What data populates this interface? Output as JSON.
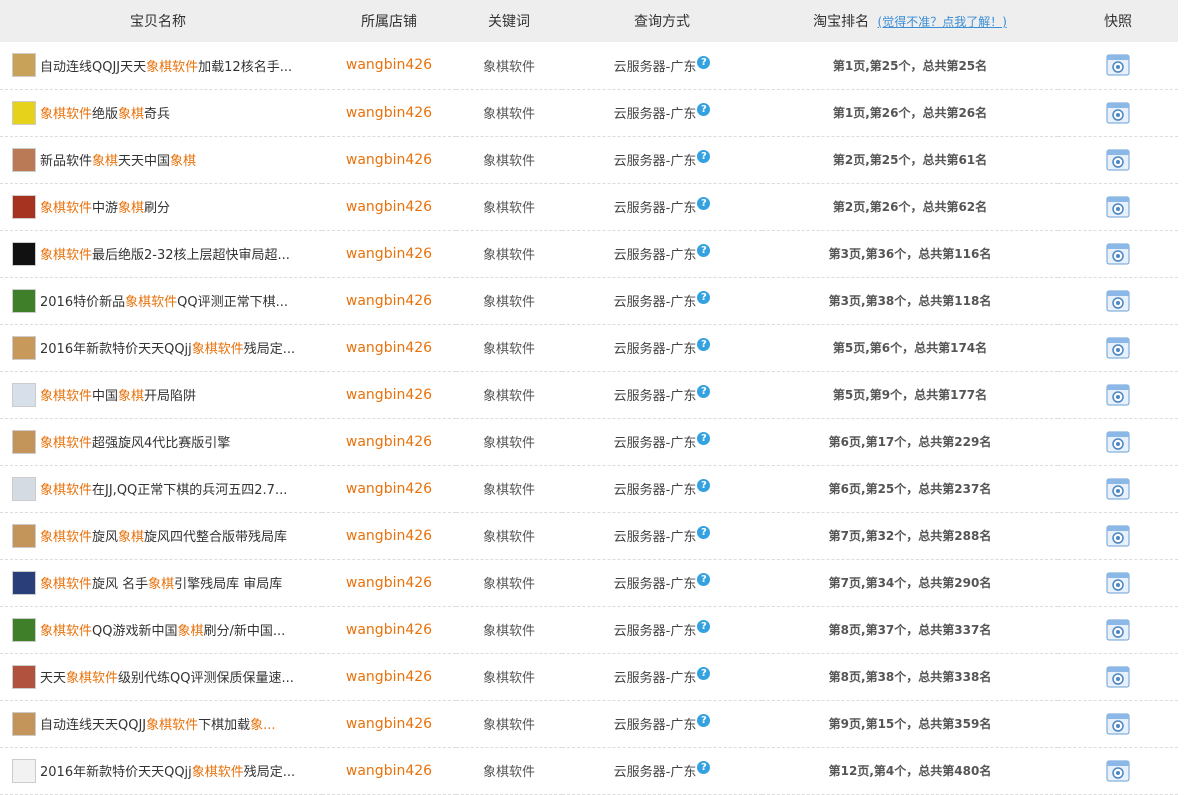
{
  "header": {
    "col_name": "宝贝名称",
    "col_store": "所属店铺",
    "col_keyword": "关键词",
    "col_method": "查询方式",
    "col_rank": "淘宝排名",
    "rank_hint": "(觉得不准？点我了解！)",
    "col_snapshot": "快照"
  },
  "rows": [
    {
      "thumb": "#c9a25a",
      "parts": [
        {
          "t": "自动连线QQJJ天天"
        },
        {
          "t": "象棋软件",
          "h": true
        },
        {
          "t": "加载12核名手..."
        }
      ],
      "store": "wangbin426",
      "keyword": "象棋软件",
      "method": "云服务器-广东",
      "rank": "第1页,第25个，总共第25名"
    },
    {
      "thumb": "#e6d21a",
      "parts": [
        {
          "t": "象棋软件",
          "h": true
        },
        {
          "t": "绝版"
        },
        {
          "t": "象棋",
          "h": true
        },
        {
          "t": "奇兵"
        }
      ],
      "store": "wangbin426",
      "keyword": "象棋软件",
      "method": "云服务器-广东",
      "rank": "第1页,第26个，总共第26名"
    },
    {
      "thumb": "#b97a55",
      "parts": [
        {
          "t": "新品软件"
        },
        {
          "t": "象棋",
          "h": true
        },
        {
          "t": "天天中国"
        },
        {
          "t": "象棋",
          "h": true
        }
      ],
      "store": "wangbin426",
      "keyword": "象棋软件",
      "method": "云服务器-广东",
      "rank": "第2页,第25个，总共第61名"
    },
    {
      "thumb": "#a5331f",
      "parts": [
        {
          "t": "象棋软件",
          "h": true
        },
        {
          "t": "中游"
        },
        {
          "t": "象棋",
          "h": true
        },
        {
          "t": "刷分"
        }
      ],
      "store": "wangbin426",
      "keyword": "象棋软件",
      "method": "云服务器-广东",
      "rank": "第2页,第26个，总共第62名"
    },
    {
      "thumb": "#111111",
      "parts": [
        {
          "t": "象棋软件",
          "h": true
        },
        {
          "t": "最后绝版2-32核上层超快审局超..."
        }
      ],
      "store": "wangbin426",
      "keyword": "象棋软件",
      "method": "云服务器-广东",
      "rank": "第3页,第36个，总共第116名"
    },
    {
      "thumb": "#3f7f2a",
      "parts": [
        {
          "t": "2016特价新品"
        },
        {
          "t": "象棋软件",
          "h": true
        },
        {
          "t": "QQ评测正常下棋..."
        }
      ],
      "store": "wangbin426",
      "keyword": "象棋软件",
      "method": "云服务器-广东",
      "rank": "第3页,第38个，总共第118名"
    },
    {
      "thumb": "#c79a5c",
      "parts": [
        {
          "t": "2016年新款特价天天QQjj"
        },
        {
          "t": "象棋软件",
          "h": true
        },
        {
          "t": "残局定..."
        }
      ],
      "store": "wangbin426",
      "keyword": "象棋软件",
      "method": "云服务器-广东",
      "rank": "第5页,第6个，总共第174名"
    },
    {
      "thumb": "#d7e0ea",
      "parts": [
        {
          "t": "象棋软件",
          "h": true
        },
        {
          "t": "中国"
        },
        {
          "t": "象棋",
          "h": true
        },
        {
          "t": "开局陷阱"
        }
      ],
      "store": "wangbin426",
      "keyword": "象棋软件",
      "method": "云服务器-广东",
      "rank": "第5页,第9个，总共第177名"
    },
    {
      "thumb": "#c4955a",
      "parts": [
        {
          "t": "象棋软件",
          "h": true
        },
        {
          "t": "超强旋风4代比赛版引擎"
        }
      ],
      "store": "wangbin426",
      "keyword": "象棋软件",
      "method": "云服务器-广东",
      "rank": "第6页,第17个，总共第229名"
    },
    {
      "thumb": "#d5dbe2",
      "parts": [
        {
          "t": "象棋软件",
          "h": true
        },
        {
          "t": "在JJ,QQ正常下棋的兵河五四2.7..."
        }
      ],
      "store": "wangbin426",
      "keyword": "象棋软件",
      "method": "云服务器-广东",
      "rank": "第6页,第25个，总共第237名"
    },
    {
      "thumb": "#c4955a",
      "parts": [
        {
          "t": "象棋软件",
          "h": true
        },
        {
          "t": "旋风"
        },
        {
          "t": "象棋",
          "h": true
        },
        {
          "t": "旋风四代整合版带残局库"
        }
      ],
      "store": "wangbin426",
      "keyword": "象棋软件",
      "method": "云服务器-广东",
      "rank": "第7页,第32个，总共第288名"
    },
    {
      "thumb": "#2a3f7a",
      "parts": [
        {
          "t": "象棋软件",
          "h": true
        },
        {
          "t": "旋风 名手"
        },
        {
          "t": "象棋",
          "h": true
        },
        {
          "t": "引擎残局库 审局库"
        }
      ],
      "store": "wangbin426",
      "keyword": "象棋软件",
      "method": "云服务器-广东",
      "rank": "第7页,第34个，总共第290名"
    },
    {
      "thumb": "#3f7f2a",
      "parts": [
        {
          "t": "象棋软件",
          "h": true
        },
        {
          "t": "QQ游戏新中国"
        },
        {
          "t": "象棋",
          "h": true
        },
        {
          "t": "刷分/新中国..."
        }
      ],
      "store": "wangbin426",
      "keyword": "象棋软件",
      "method": "云服务器-广东",
      "rank": "第8页,第37个，总共第337名"
    },
    {
      "thumb": "#b0523d",
      "parts": [
        {
          "t": "天天"
        },
        {
          "t": "象棋软件",
          "h": true
        },
        {
          "t": "级别代练QQ评测保质保量速..."
        }
      ],
      "store": "wangbin426",
      "keyword": "象棋软件",
      "method": "云服务器-广东",
      "rank": "第8页,第38个，总共第338名"
    },
    {
      "thumb": "#c4955a",
      "parts": [
        {
          "t": "自动连线天天QQJJ"
        },
        {
          "t": "象棋软件",
          "h": true
        },
        {
          "t": "下棋加载"
        },
        {
          "t": "象...",
          "h": true
        }
      ],
      "store": "wangbin426",
      "keyword": "象棋软件",
      "method": "云服务器-广东",
      "rank": "第9页,第15个，总共第359名"
    },
    {
      "thumb": "#f2f2f2",
      "parts": [
        {
          "t": "2016年新款特价天天QQjj"
        },
        {
          "t": "象棋软件",
          "h": true
        },
        {
          "t": "残局定..."
        }
      ],
      "store": "wangbin426",
      "keyword": "象棋软件",
      "method": "云服务器-广东",
      "rank": "第12页,第4个，总共第480名"
    }
  ],
  "icons": {
    "help": "question-icon",
    "snapshot": "snapshot-icon"
  },
  "colors": {
    "accent": "#e8720c",
    "link": "#3a8ed6",
    "header_bg": "#eeeeee",
    "help_icon": "#34a1e0"
  }
}
